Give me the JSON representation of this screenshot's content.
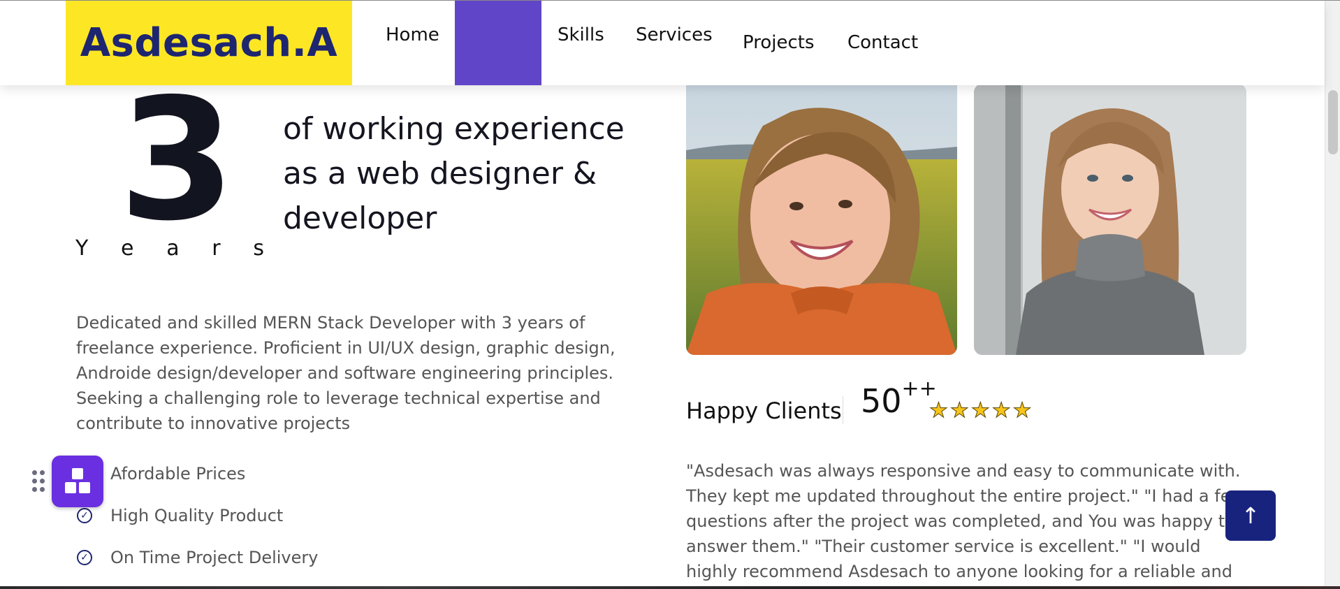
{
  "nav": {
    "brand": "Asdesach.A",
    "links": [
      "Home",
      "Skills",
      "Services",
      "Projects",
      "Contact"
    ]
  },
  "experience": {
    "number": "3",
    "unit_letters": [
      "Y",
      "e",
      "a",
      "r",
      "s"
    ],
    "headline": "of working experience as a web designer & developer"
  },
  "about": {
    "description": "Dedicated and skilled MERN Stack Developer with 3 years of freelance experience. Proficient in UI/UX design, graphic design, Androide design/developer and software engineering principles. Seeking a challenging role to leverage technical expertise and contribute to innovative projects",
    "features": [
      "Afordable Prices",
      "High Quality Product",
      "On Time Project Delivery"
    ]
  },
  "photos": [
    {
      "alt": "smiling woman in orange sweater in a field"
    },
    {
      "alt": "smiling girl in gray sweater"
    }
  ],
  "clients": {
    "label": "Happy Clients",
    "count": "50",
    "count_suffix": "++",
    "stars": 5,
    "testimonial": "\"Asdesach was always responsive and easy to communicate with. They kept me updated throughout the entire project.\" \"I had a few questions after the project was completed, and You was happy to answer them.\" \"Their customer service is excellent.\" \"I would highly recommend Asdesach to anyone looking for a reliable and talented freelancer.\"."
  },
  "icons": {
    "check": "check-circle-icon",
    "to_top": "arrow-up-icon",
    "widget": "blocks-icon",
    "drag": "drag-handle-icon",
    "star": "star-icon"
  },
  "colors": {
    "brand_bg": "#fde725",
    "brand_text": "#1e2670",
    "accent_purple": "#6145c9",
    "widget_purple": "#6a2fe0",
    "navy_button": "#18237e",
    "star": "#f7c41b"
  }
}
